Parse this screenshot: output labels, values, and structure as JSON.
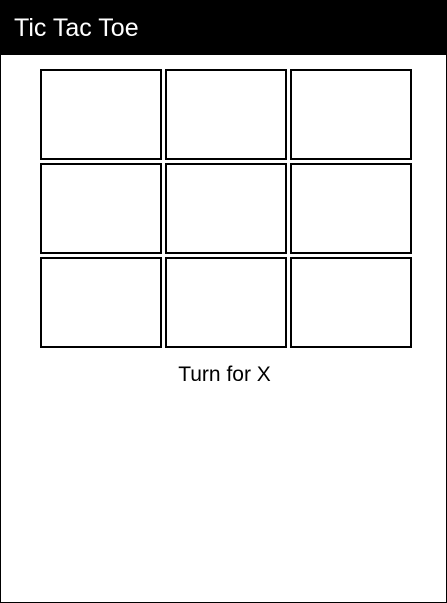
{
  "app": {
    "title": "Tic Tac Toe"
  },
  "board": {
    "cells": [
      "",
      "",
      "",
      "",
      "",
      "",
      "",
      "",
      ""
    ]
  },
  "status": {
    "text": "Turn for X"
  },
  "colors": {
    "header_background": "#000000",
    "header_text": "#ffffff",
    "cell_border": "#000000",
    "page_background": "#ffffff"
  }
}
